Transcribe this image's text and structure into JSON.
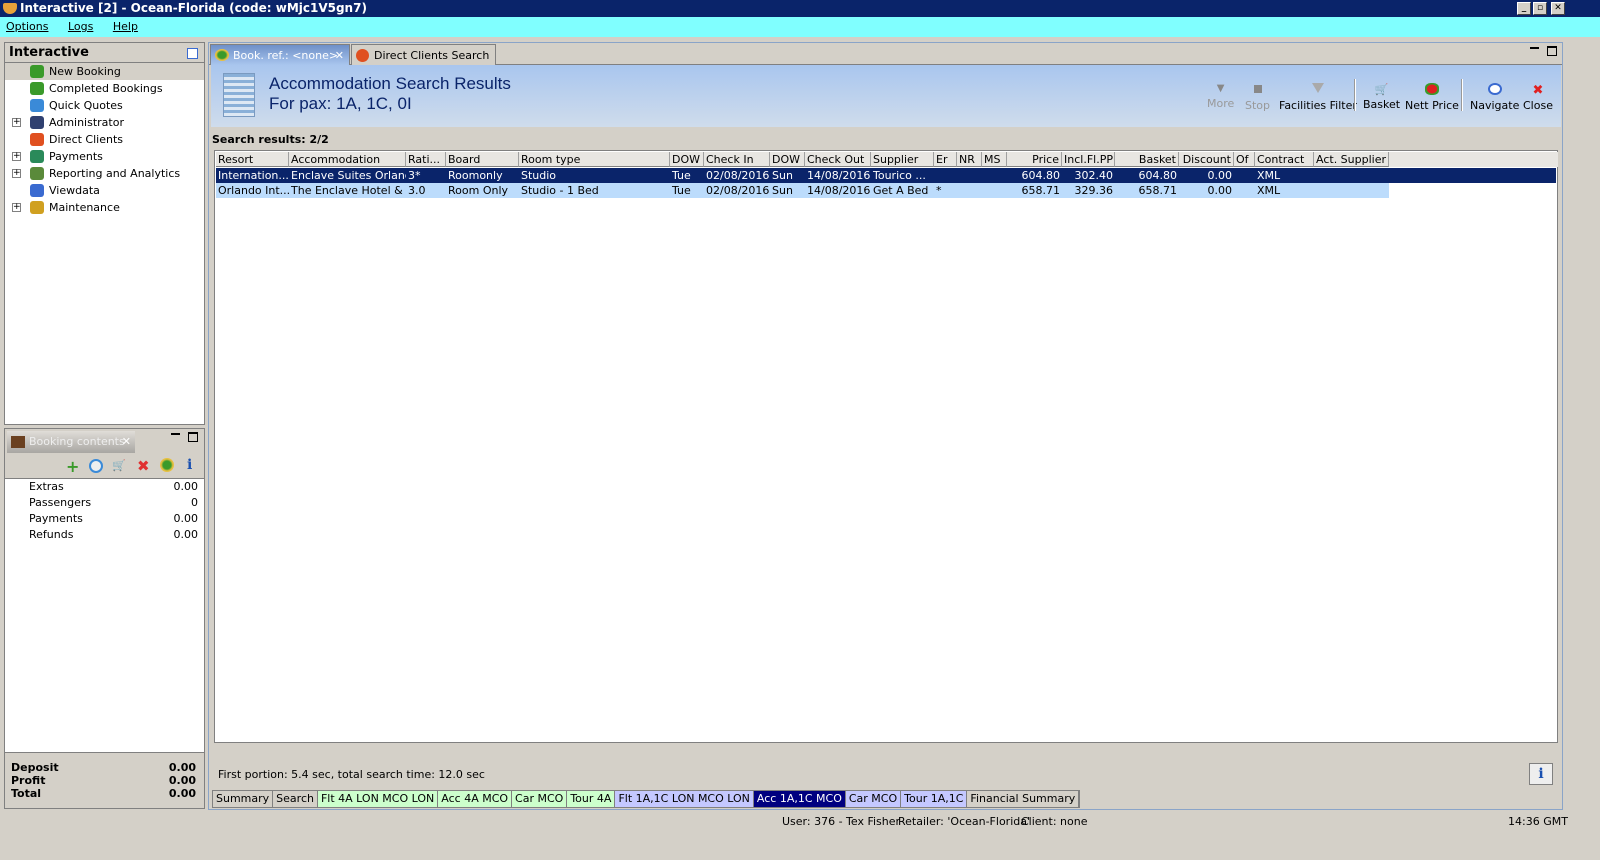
{
  "window": {
    "title": "Interactive [2] - Ocean-Florida (code: wMjc1V5gn7)"
  },
  "menu": [
    "Options",
    "Logs",
    "Help"
  ],
  "sidebar": {
    "title": "Interactive",
    "items": [
      {
        "label": "New Booking",
        "icon": "palm-tree-icon",
        "expandable": false,
        "selected": true,
        "color": "#3a9a2a"
      },
      {
        "label": "Completed Bookings",
        "icon": "palm-money-icon",
        "expandable": false,
        "color": "#3a9a2a"
      },
      {
        "label": "Quick Quotes",
        "icon": "clock-icon",
        "expandable": false,
        "color": "#3a8ad8"
      },
      {
        "label": "Administrator",
        "icon": "admin-icon",
        "expandable": true,
        "color": "#304070"
      },
      {
        "label": "Direct Clients",
        "icon": "client-icon",
        "expandable": false,
        "color": "#e05020"
      },
      {
        "label": "Payments",
        "icon": "payments-icon",
        "expandable": true,
        "color": "#2a8a5a"
      },
      {
        "label": "Reporting and Analytics",
        "icon": "report-icon",
        "expandable": true,
        "color": "#5a8a3a"
      },
      {
        "label": "Viewdata",
        "icon": "globe-icon",
        "expandable": false,
        "color": "#3a6ad0"
      },
      {
        "label": "Maintenance",
        "icon": "maintenance-icon",
        "expandable": true,
        "color": "#d0a020"
      }
    ]
  },
  "booking": {
    "tab": "Booking contents",
    "rows": [
      {
        "label": "Extras",
        "value": "0.00"
      },
      {
        "label": "Passengers",
        "value": "0"
      },
      {
        "label": "Payments",
        "value": "0.00"
      },
      {
        "label": "Refunds",
        "value": "0.00"
      }
    ],
    "totals": [
      {
        "label": "Deposit",
        "value": "0.00"
      },
      {
        "label": "Profit",
        "value": "0.00"
      },
      {
        "label": "Total",
        "value": "0.00"
      }
    ]
  },
  "main": {
    "tabs": [
      "Book. ref.: <none>",
      "Direct Clients Search"
    ],
    "title": "Accommodation Search Results",
    "subtitle": "For pax: 1A, 1C, 0I",
    "toolbar": [
      {
        "label": "More",
        "disabled": true
      },
      {
        "label": "Stop",
        "disabled": true
      },
      {
        "label": "Facilities Filter"
      },
      {
        "label": "Basket"
      },
      {
        "label": "Nett Price"
      },
      {
        "label": "Navigate"
      },
      {
        "label": "Close"
      }
    ],
    "results_label": "Search results: 2/2",
    "columns": [
      "Resort",
      "Accommodation",
      "Rati...",
      "Board",
      "Room type",
      "DOW",
      "Check In",
      "DOW",
      "Check Out",
      "Supplier",
      "Er",
      "NR",
      "MS",
      "Price",
      "Incl.Fl.PP",
      "Basket",
      "Discount",
      "Of",
      "Contract",
      "Act. Supplier"
    ],
    "rows": [
      [
        "Internation...",
        "Enclave Suites Orlando",
        "3*",
        "Roomonly",
        "Studio",
        "Tue",
        "02/08/2016",
        "Sun",
        "14/08/2016",
        "Tourico ...",
        "",
        "",
        "",
        "604.80",
        "302.40",
        "604.80",
        "0.00",
        "",
        "XML",
        ""
      ],
      [
        "Orlando Int...",
        "The Enclave Hotel & ...",
        "3.0",
        "Room Only",
        "Studio - 1 Bed",
        "Tue",
        "02/08/2016",
        "Sun",
        "14/08/2016",
        "Get A Bed",
        "*",
        "",
        "",
        "658.71",
        "329.36",
        "658.71",
        "0.00",
        "",
        "XML",
        ""
      ]
    ],
    "status": "First portion: 5.4 sec, total search time: 12.0 sec",
    "bottom_tabs": [
      {
        "label": "Summary",
        "color": "#d4d0c8"
      },
      {
        "label": "Search",
        "color": "#d4d0c8"
      },
      {
        "label": "Flt 4A LON MCO LON",
        "color": "#ccffcc"
      },
      {
        "label": "Acc 4A MCO",
        "color": "#ccffcc"
      },
      {
        "label": "Car MCO",
        "color": "#ccffcc"
      },
      {
        "label": "Tour 4A",
        "color": "#ccffcc"
      },
      {
        "label": "Flt 1A,1C LON MCO LON",
        "color": "#c4c8ff"
      },
      {
        "label": "Acc 1A,1C MCO",
        "color": "#000080",
        "active": true
      },
      {
        "label": "Car MCO",
        "color": "#c4c8ff"
      },
      {
        "label": "Tour 1A,1C",
        "color": "#c4c8ff"
      },
      {
        "label": "Financial Summary",
        "color": "#d4d0c8"
      }
    ]
  },
  "statusbar": {
    "user": "User: 376 - Tex Fisher",
    "retailer": "Retailer: 'Ocean-Florida'",
    "client": "Client: none",
    "time": "14:36 GMT"
  }
}
